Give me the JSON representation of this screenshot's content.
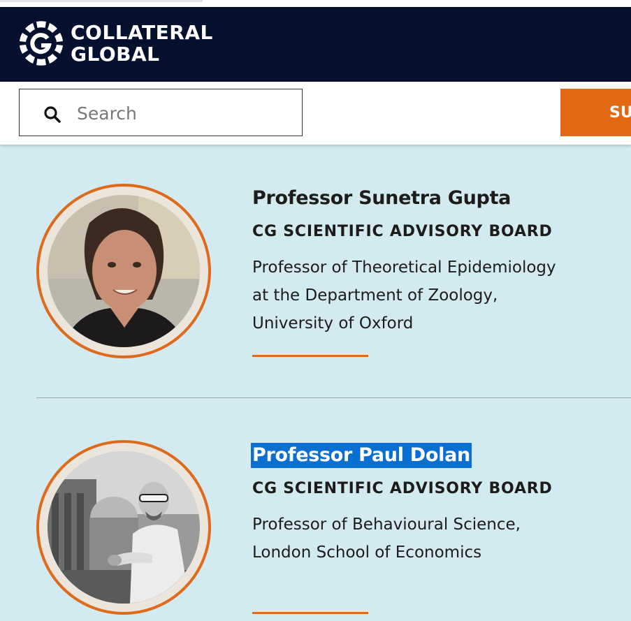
{
  "brand": {
    "line1": "COLLATERAL",
    "line2": "GLOBAL",
    "logo_icon": "cg-logo-icon",
    "header_color": "#05102e",
    "accent_color": "#de6a1c"
  },
  "search": {
    "placeholder": "Search",
    "value": "",
    "icon": "search-icon"
  },
  "cta": {
    "label": "SU"
  },
  "people": [
    {
      "name": "Professor Sunetra Gupta",
      "board": "CG SCIENTIFIC ADVISORY BOARD",
      "desc_lines": [
        "Professor of Theoretical Epidemiology",
        "at the Department of Zoology,",
        "University of Oxford"
      ],
      "selected": false
    },
    {
      "name": "Professor Paul Dolan",
      "board": "CG SCIENTIFIC ADVISORY BOARD",
      "desc_lines": [
        "Professor of Behavioural Science,",
        "London School of Economics"
      ],
      "selected": true
    }
  ]
}
